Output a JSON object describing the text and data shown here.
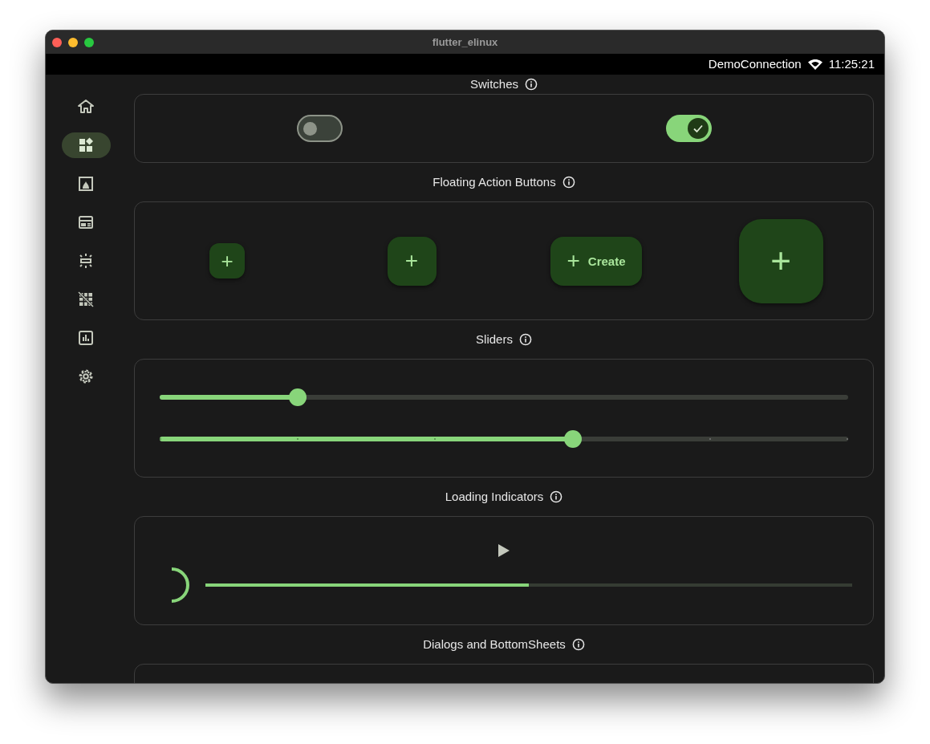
{
  "window": {
    "title": "flutter_elinux"
  },
  "status_bar": {
    "network": "DemoConnection",
    "time": "11:25:21"
  },
  "nav": [
    {
      "kind": "home",
      "selected": false
    },
    {
      "kind": "widgets",
      "selected": true
    },
    {
      "kind": "color",
      "selected": false
    },
    {
      "kind": "typography",
      "selected": false
    },
    {
      "kind": "elevation",
      "selected": false
    },
    {
      "kind": "grid",
      "selected": false
    },
    {
      "kind": "chart",
      "selected": false
    },
    {
      "kind": "settings",
      "selected": false
    }
  ],
  "sections": [
    {
      "title": "Switches",
      "kind": "switches",
      "switches": [
        {
          "on": false
        },
        {
          "on": true
        }
      ]
    },
    {
      "title": "Floating Action Buttons",
      "kind": "fabs",
      "buttons": [
        {
          "kind": "small",
          "icon": "+"
        },
        {
          "kind": "regular",
          "icon": "+"
        },
        {
          "kind": "extended",
          "icon": "+",
          "label": "Create"
        },
        {
          "kind": "large",
          "icon": "+"
        }
      ]
    },
    {
      "title": "Sliders",
      "kind": "sliders",
      "sliders": [
        {
          "level": 0.2,
          "kind": "continuous"
        },
        {
          "level": 0.6,
          "kind": "discrete"
        }
      ]
    },
    {
      "title": "Loading Indicators",
      "kind": "loading",
      "progress": {
        "level": 0.5
      }
    },
    {
      "title": "Dialogs and BottomSheets",
      "kind": "dialogs"
    }
  ]
}
